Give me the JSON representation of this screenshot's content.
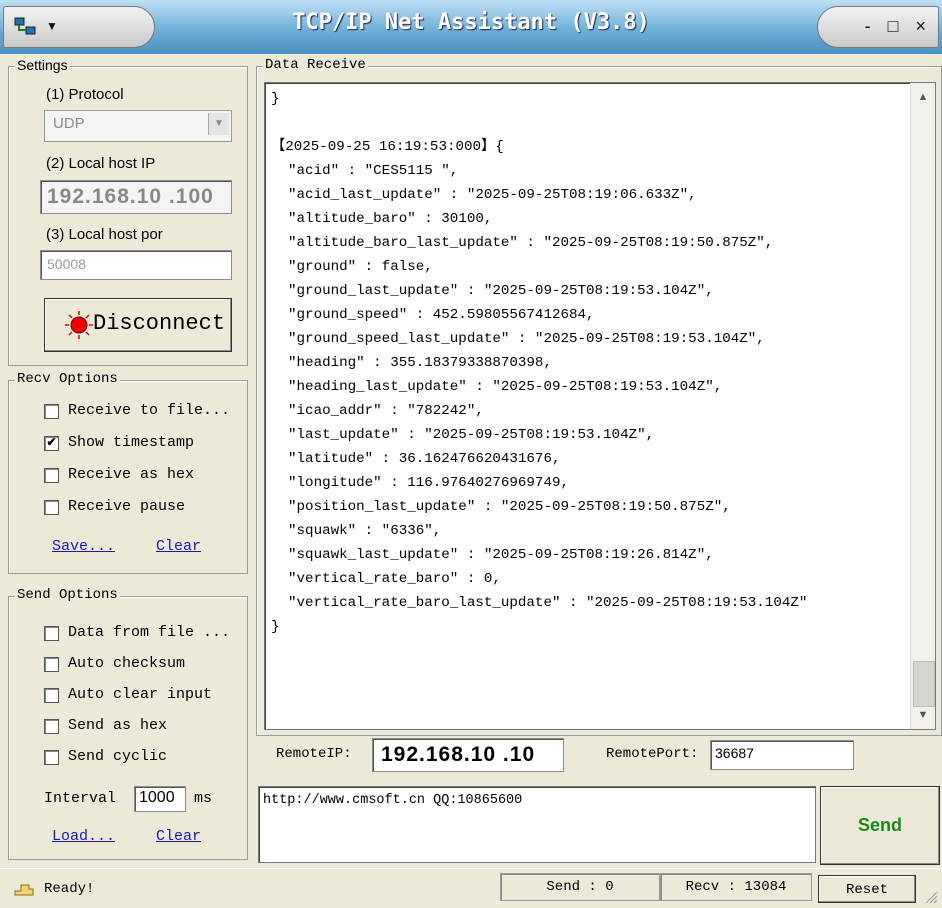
{
  "window": {
    "title": "TCP/IP Net Assistant (V3.8)",
    "menu_caret": "▼",
    "controls": "- □ ×"
  },
  "settings": {
    "legend": "Settings",
    "protocol_label": "(1) Protocol",
    "protocol_value": "UDP",
    "local_ip_label": "(2) Local host IP",
    "local_ip_value": "192.168.10 .100",
    "local_port_label": "(3) Local host por",
    "local_port_value": "50008",
    "disconnect_label": "Disconnect"
  },
  "recv_options": {
    "legend": "Recv Options",
    "items": [
      {
        "label": "Receive to file...",
        "checked": false
      },
      {
        "label": "Show timestamp",
        "checked": true
      },
      {
        "label": "Receive as hex",
        "checked": false
      },
      {
        "label": "Receive pause",
        "checked": false
      }
    ],
    "save_link": "Save...",
    "clear_link": "Clear"
  },
  "send_options": {
    "legend": "Send Options",
    "items": [
      {
        "label": "Data from file ...",
        "checked": false
      },
      {
        "label": "Auto checksum",
        "checked": false
      },
      {
        "label": "Auto clear input",
        "checked": false
      },
      {
        "label": "Send as hex",
        "checked": false
      },
      {
        "label": "Send cyclic",
        "checked": false
      }
    ],
    "interval_label": "Interval",
    "interval_value": "1000",
    "interval_unit": "ms",
    "load_link": "Load...",
    "clear_link": "Clear"
  },
  "data_receive": {
    "legend": "Data Receive",
    "lines": [
      "}",
      "",
      "【2025-09-25 16:19:53:000】{",
      "  \"acid\" : \"CES5115 \",",
      "  \"acid_last_update\" : \"2025-09-25T08:19:06.633Z\",",
      "  \"altitude_baro\" : 30100,",
      "  \"altitude_baro_last_update\" : \"2025-09-25T08:19:50.875Z\",",
      "  \"ground\" : false,",
      "  \"ground_last_update\" : \"2025-09-25T08:19:53.104Z\",",
      "  \"ground_speed\" : 452.59805567412684,",
      "  \"ground_speed_last_update\" : \"2025-09-25T08:19:53.104Z\",",
      "  \"heading\" : 355.18379338870398,",
      "  \"heading_last_update\" : \"2025-09-25T08:19:53.104Z\",",
      "  \"icao_addr\" : \"782242\",",
      "  \"last_update\" : \"2025-09-25T08:19:53.104Z\",",
      "  \"latitude\" : 36.162476620431676,",
      "  \"longitude\" : 116.97640276969749,",
      "  \"position_last_update\" : \"2025-09-25T08:19:50.875Z\",",
      "  \"squawk\" : \"6336\",",
      "  \"squawk_last_update\" : \"2025-09-25T08:19:26.814Z\",",
      "  \"vertical_rate_baro\" : 0,",
      "  \"vertical_rate_baro_last_update\" : \"2025-09-25T08:19:53.104Z\"",
      "}"
    ]
  },
  "remote": {
    "ip_label": "RemoteIP:",
    "ip_value": "192.168.10 .10",
    "port_label": "RemotePort:",
    "port_value": "36687"
  },
  "send": {
    "text": "http://www.cmsoft.cn QQ:10865600",
    "button": "Send",
    "button_color": "#1a8a1a"
  },
  "status": {
    "ready": "Ready!",
    "send_count": "Send : 0",
    "recv_count": "Recv : 13084",
    "reset": "Reset"
  }
}
